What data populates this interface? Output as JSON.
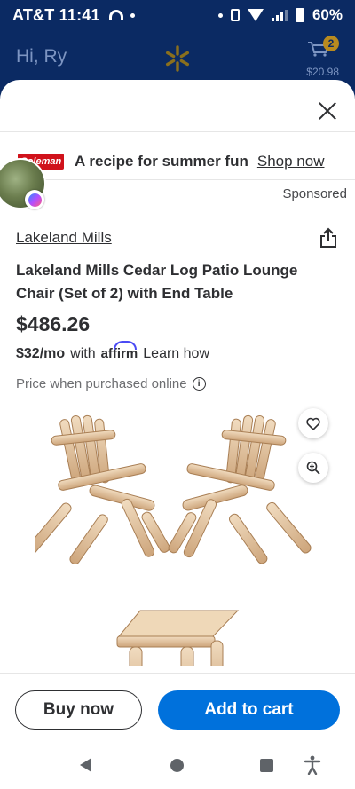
{
  "status_bar": {
    "carrier_time": "AT&T 11:41",
    "battery": "60%"
  },
  "app_bar": {
    "greeting": "Hi, Ry",
    "cart_count": "2",
    "cart_total": "$20.98"
  },
  "ad": {
    "brand_logo": "Coleman",
    "headline": "A recipe for summer fun",
    "cta": "Shop now",
    "sponsored_label": "Sponsored"
  },
  "product": {
    "brand": "Lakeland Mills",
    "title": "Lakeland Mills Cedar Log Patio Lounge Chair (Set of 2) with End Table",
    "price": "$486.26",
    "monthly_amount": "$32/mo",
    "monthly_with": "with",
    "affirm": "affirm",
    "learn_how": "Learn how",
    "price_note": "Price when purchased online"
  },
  "actions": {
    "buy_now": "Buy now",
    "add_to_cart": "Add to cart"
  },
  "colors": {
    "header_blue": "#0b2a63",
    "primary_blue": "#0071dc",
    "spark_yellow": "#b88a1f"
  },
  "icons": [
    "wifi-icon",
    "cart-icon",
    "spark-icon",
    "close-icon",
    "messenger-icon",
    "share-icon",
    "info-icon",
    "heart-icon",
    "zoom-icon",
    "back-nav-icon",
    "home-nav-icon",
    "recents-nav-icon",
    "accessibility-icon"
  ]
}
